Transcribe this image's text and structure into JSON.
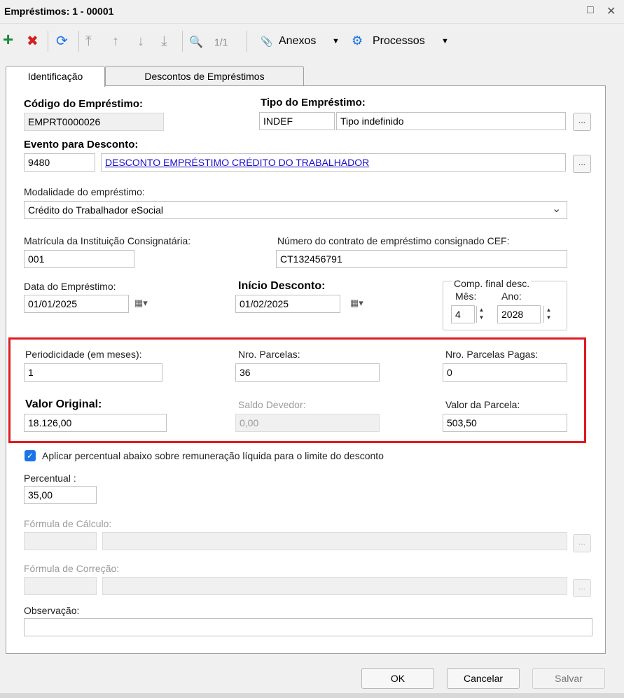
{
  "window": {
    "title": "Empréstimos: 1 - 00001",
    "maximize_glyph": "□",
    "close_glyph": "✕"
  },
  "toolbar": {
    "add_glyph": "+",
    "delete_glyph": "✖",
    "refresh_glyph": "⟳",
    "first_glyph": "⤒",
    "prev_glyph": "↑",
    "next_glyph": "↓",
    "last_glyph": "⤓",
    "search_glyph": "🔍",
    "page_indicator": "1/1",
    "attach_glyph": "📎",
    "attachments_label": "Anexos",
    "attachments_caret": "▼",
    "gear_glyph": "⚙",
    "processes_label": "Processos",
    "processes_caret": "▼"
  },
  "tabs": [
    {
      "label": "Identificação",
      "active": true
    },
    {
      "label": "Descontos de Empréstimos",
      "active": false
    }
  ],
  "form": {
    "loan_code": {
      "label": "Código do Empréstimo:",
      "value": "EMPRT0000026"
    },
    "loan_type": {
      "label": "Tipo do Empréstimo:",
      "code": "INDEF",
      "description": "Tipo indefinido"
    },
    "discount_event": {
      "label": "Evento para Desconto:",
      "code": "9480",
      "description": "DESCONTO EMPRÉSTIMO CRÉDITO DO TRABALHADOR"
    },
    "modality": {
      "label": "Modalidade do empréstimo:",
      "value": "Crédito do Trabalhador eSocial"
    },
    "institution_registration": {
      "label": "Matrícula da Instituição Consignatária:",
      "value": "001"
    },
    "contract_number": {
      "label": "Número do contrato de empréstimo consignado CEF:",
      "value": "CT132456791"
    },
    "loan_date": {
      "label": "Data do Empréstimo:",
      "value": "01/01/2025"
    },
    "discount_start": {
      "label": "Início Desconto:",
      "value": "01/02/2025"
    },
    "final_comp": {
      "label": "Comp. final desc.",
      "month_label": "Mês:",
      "month": "4",
      "year_label": "Ano:",
      "year": "2028"
    },
    "periodicity": {
      "label": "Periodicidade (em meses):",
      "value": "1"
    },
    "installments": {
      "label": "Nro. Parcelas:",
      "value": "36"
    },
    "installments_paid": {
      "label": "Nro. Parcelas Pagas:",
      "value": "0"
    },
    "original_value": {
      "label": "Valor Original:",
      "value": "18.126,00"
    },
    "balance": {
      "label": "Saldo Devedor:",
      "value": "0,00"
    },
    "installment_value": {
      "label": "Valor da Parcela:",
      "value": "503,50"
    },
    "apply_percentage": {
      "label": "Aplicar percentual abaixo sobre remuneração líquida para o limite do desconto",
      "checked": true,
      "check_glyph": "✓"
    },
    "percentage": {
      "label": "Percentual :",
      "value": "35,00"
    },
    "calc_formula": {
      "label": "Fórmula de Cálculo:",
      "code": "",
      "description": ""
    },
    "correction_formula": {
      "label": "Fórmula de Correção:",
      "code": "",
      "description": ""
    },
    "observation": {
      "label": "Observação:",
      "value": ""
    },
    "lookup_label": "...",
    "calendar_glyph": "▦▾",
    "spin_up": "▲",
    "spin_down": "▼",
    "dropdown_caret": "⌄"
  },
  "footer": {
    "ok_label": "OK",
    "cancel_label": "Cancelar",
    "save_label": "Salvar"
  },
  "colors": {
    "highlight_border": "#e0191e",
    "checkbox": "#1a73e8",
    "link": "#1a0dcc",
    "add": "#1a8a3a",
    "delete": "#d42020"
  }
}
